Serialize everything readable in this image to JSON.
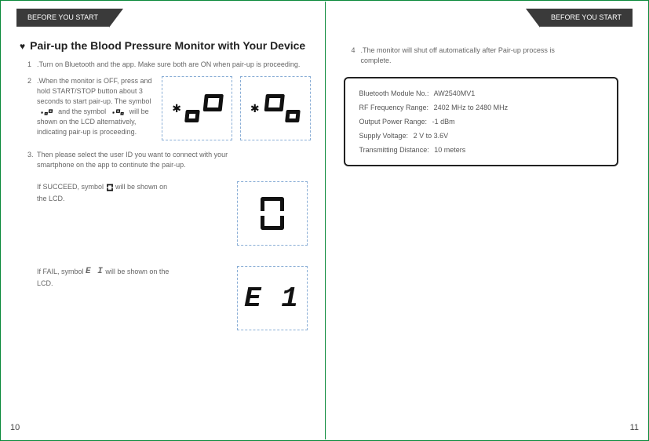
{
  "left": {
    "section": "BEFORE YOU START",
    "title": "Pair-up the Blood Pressure Monitor with Your Device",
    "steps": {
      "s1_num": "1",
      "s1": ".Turn on Bluetooth and the app. Make sure both are ON when pair-up is proceeding.",
      "s2_num": "2",
      "s2a": ".When the monitor is OFF, press and hold START/STOP button about 3 seconds to start pair-up. The symbol ",
      "s2b": " and the symbol ",
      "s2c": " will be shown on the LCD alternatively, indicating pair-up is proceeding.",
      "s3_num": "3.",
      "s3": " Then please select the user ID you want to connect with your smartphone on the app to continute the pair-up.",
      "s3_succ_a": "If SUCCEED, symbol ",
      "s3_succ_b": " will be shown on the LCD.",
      "s3_fail_a": "If FAIL, symbol ",
      "s3_fail_b": " will be shown on the LCD.",
      "fail_glyph": "E I"
    },
    "lcd_e1": "E 1",
    "page_num": "10"
  },
  "right": {
    "section": "BEFORE YOU START",
    "s4_num": "4",
    "s4": " .The monitor will shut off automatically after Pair-up process is complete.",
    "specs": {
      "r1_l": "Bluetooth Module No.:",
      "r1_v": "AW2540MV1",
      "r2_l": "RF Frequency Range:",
      "r2_v": "2402 MHz to 2480 MHz",
      "r3_l": "Output Power Range:",
      "r3_v": "-1 dBm",
      "r4_l": "Supply Voltage:",
      "r4_v": "2 V to 3.6V",
      "r5_l": "Transmitting Distance:",
      "r5_v": "10 meters"
    },
    "page_num": "11"
  }
}
